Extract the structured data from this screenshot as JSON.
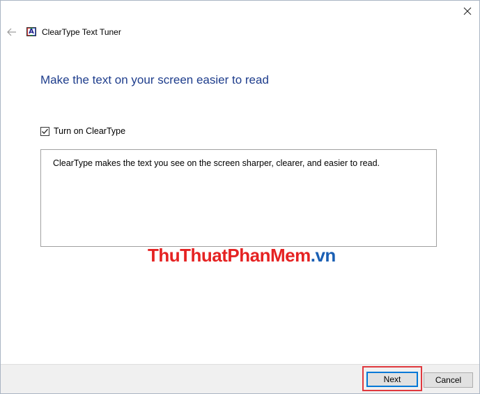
{
  "window": {
    "title": "ClearType Text Tuner",
    "icon_letter": "A"
  },
  "icons": {
    "close": "close-icon",
    "back": "back-arrow-icon",
    "app": "cleartype-app-icon",
    "check": "checkmark-icon"
  },
  "main": {
    "heading": "Make the text on your screen easier to read",
    "checkbox": {
      "label": "Turn on ClearType",
      "checked": true
    },
    "description": "ClearType makes the text you see on the screen sharper, clearer, and easier to read."
  },
  "watermark": {
    "part1": "ThuThuat",
    "part2": "PhanMem",
    "part3": ".vn"
  },
  "footer": {
    "next_label": "Next",
    "cancel_label": "Cancel"
  },
  "colors": {
    "heading": "#1e3d8c",
    "highlight": "#e0393e",
    "focus": "#0078d7",
    "watermark_red": "#e52323",
    "watermark_blue": "#1a5fb4"
  }
}
